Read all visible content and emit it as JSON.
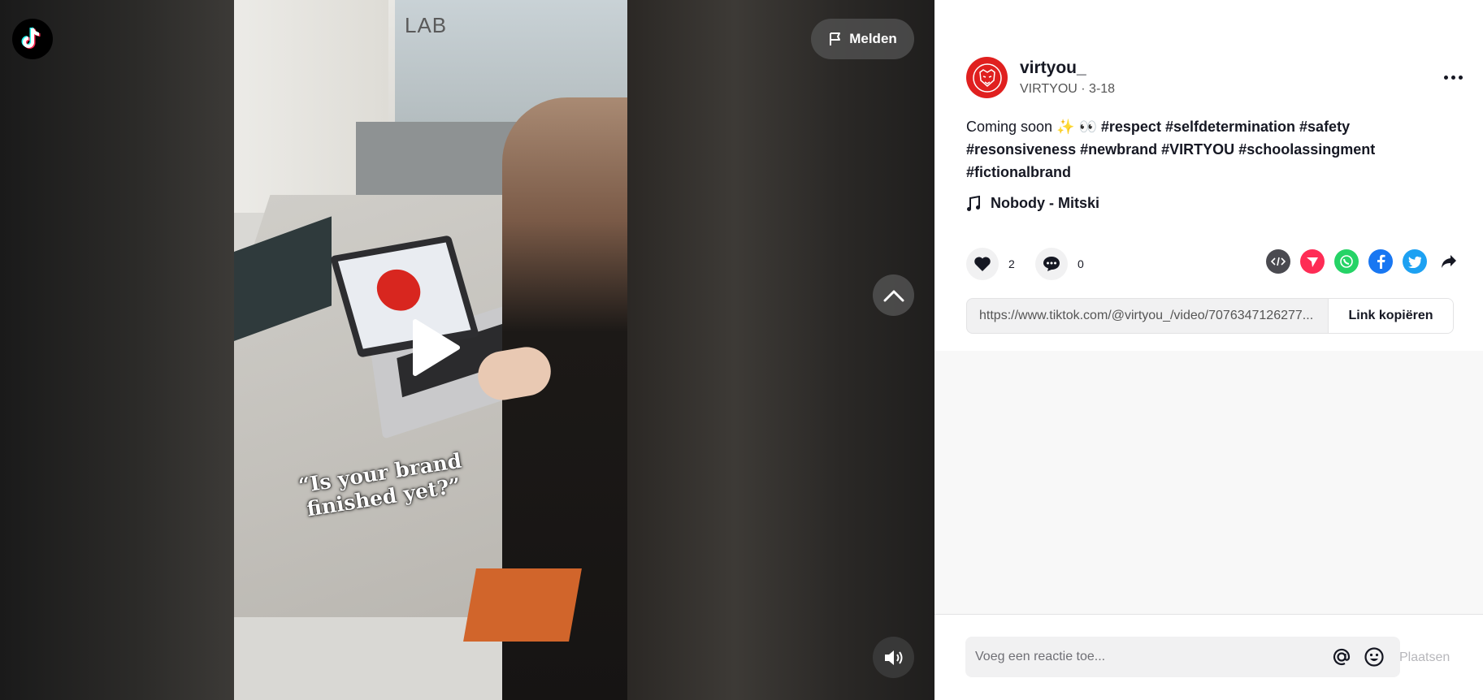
{
  "video": {
    "report_label": "Melden",
    "overlay_caption": "“Is your brand finished yet?”",
    "scene_sign": "LAB"
  },
  "author": {
    "username": "virtyou_",
    "display_name": "VIRTYOU",
    "separator": " · ",
    "date": "3-18"
  },
  "post": {
    "text": "Coming soon ✨ 👀 ",
    "hashtags": [
      "#respect",
      "#selfdetermination",
      "#safety",
      "#resonsiveness",
      "#newbrand",
      "#VIRTYOU",
      "#schoolassingment",
      "#fictionalbrand"
    ],
    "music": "Nobody - Mitski"
  },
  "stats": {
    "likes": "2",
    "comments": "0"
  },
  "share": {
    "icons": [
      "embed-icon",
      "send-to-friends-icon",
      "whatsapp-icon",
      "facebook-icon",
      "twitter-icon",
      "share-arrow-icon"
    ],
    "link": "https://www.tiktok.com/@virtyou_/video/7076347126277...",
    "copy_label": "Link kopiëren"
  },
  "comment": {
    "placeholder": "Voeg een reactie toe...",
    "post_label": "Plaatsen"
  },
  "colors": {
    "brand_red": "#e0201f",
    "tiktok_pink": "#fe2c55",
    "whatsapp": "#25d366",
    "facebook": "#1877f2",
    "twitter": "#1da1f2",
    "embed_gray": "#4a4a50"
  }
}
